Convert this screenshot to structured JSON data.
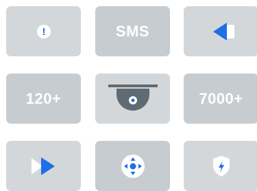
{
  "tiles": {
    "alert": {
      "icon": "exclamation-circle-icon",
      "glyph": "!"
    },
    "sms": {
      "label": "SMS"
    },
    "rewind": {
      "icon": "rewind-icon"
    },
    "count_a": {
      "label": "120+"
    },
    "camera": {
      "icon": "dome-camera-icon"
    },
    "count_b": {
      "label": "7000+"
    },
    "forward": {
      "icon": "fast-forward-icon"
    },
    "dpad": {
      "icon": "directional-pad-icon"
    },
    "shield": {
      "icon": "shield-bolt-icon"
    }
  },
  "colors": {
    "tile_light": "#d4d7da",
    "tile_dark": "#c7ccd0",
    "accent_blue": "#1f6fe5",
    "text_white": "#ffffff",
    "camera_gray": "#5f6a72"
  }
}
